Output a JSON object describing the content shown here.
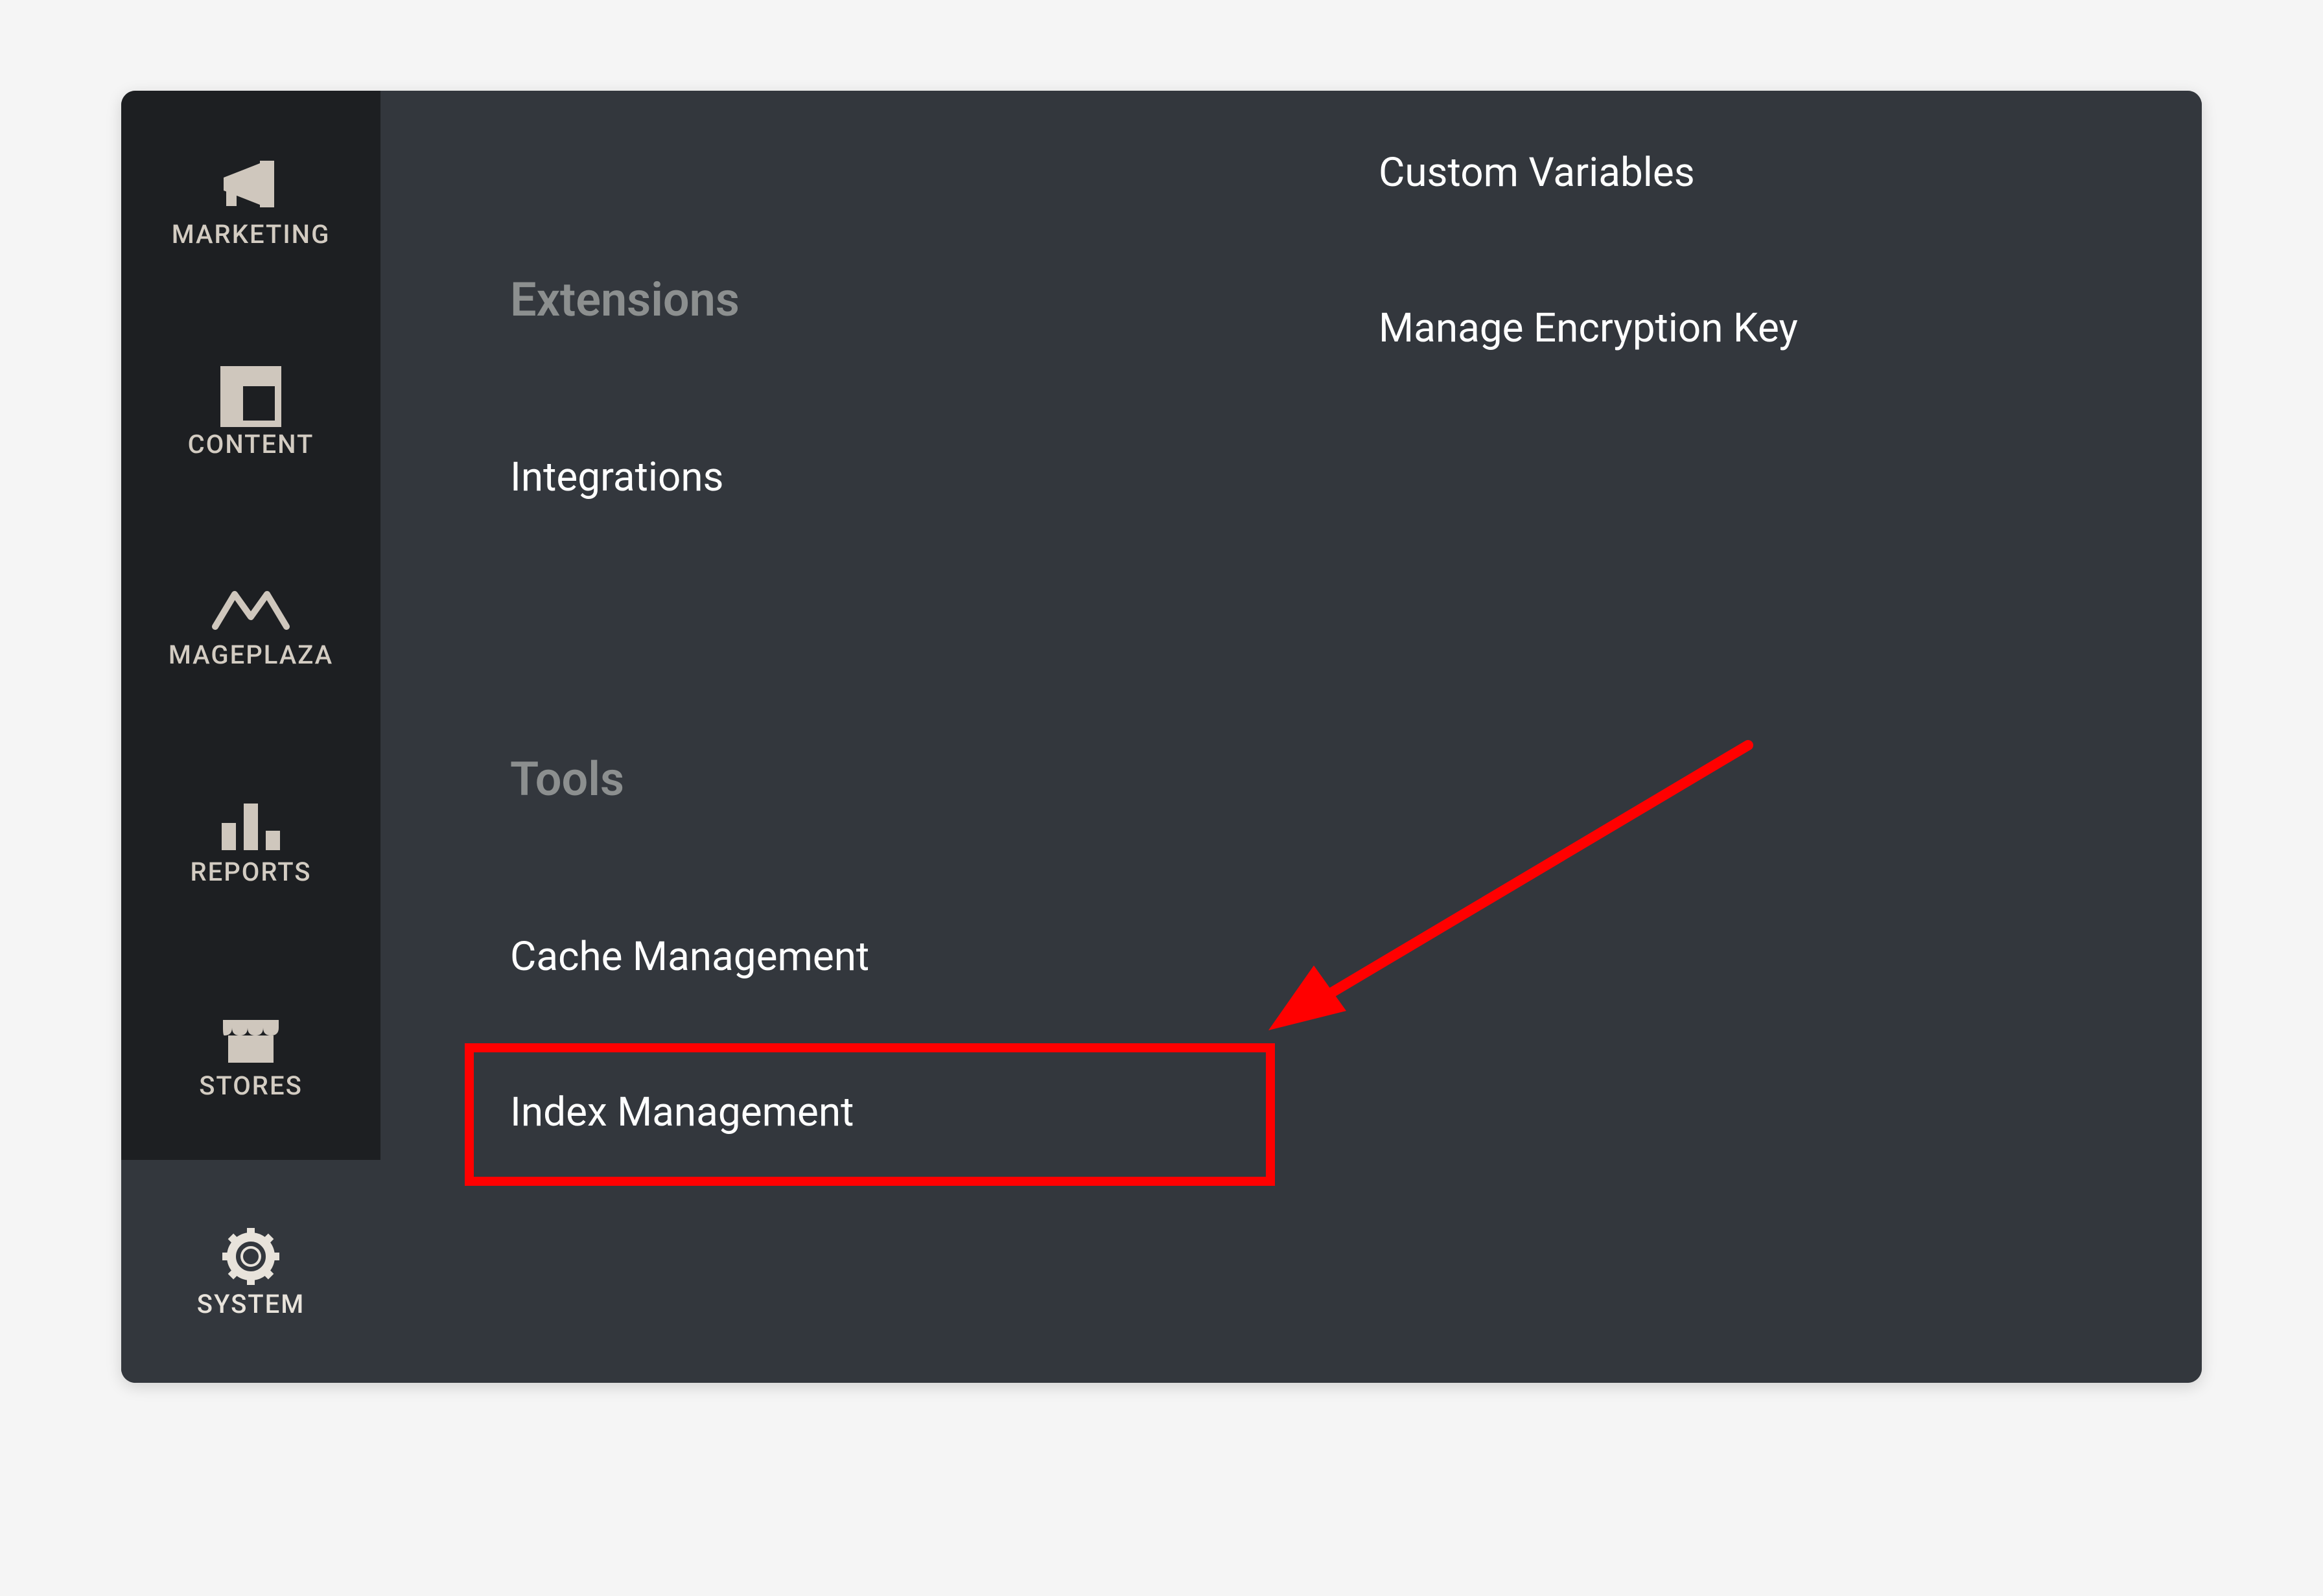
{
  "sidebar": {
    "items": [
      {
        "label": "MARKETING"
      },
      {
        "label": "CONTENT"
      },
      {
        "label": "MAGEPLAZA"
      },
      {
        "label": "REPORTS"
      },
      {
        "label": "STORES"
      },
      {
        "label": "SYSTEM"
      }
    ]
  },
  "flyout": {
    "left_column": {
      "heading1": "Extensions",
      "links1": [
        {
          "label": "Integrations"
        }
      ],
      "heading2": "Tools",
      "links2": [
        {
          "label": "Cache Management"
        },
        {
          "label": "Index Management"
        }
      ]
    },
    "right_column": {
      "links": [
        {
          "label": "Custom Variables"
        },
        {
          "label": "Manage Encryption Key"
        }
      ]
    }
  },
  "annotation": {
    "highlight_target": "Index Management",
    "highlight_color": "#ff0000",
    "arrow_color": "#ff0000"
  }
}
